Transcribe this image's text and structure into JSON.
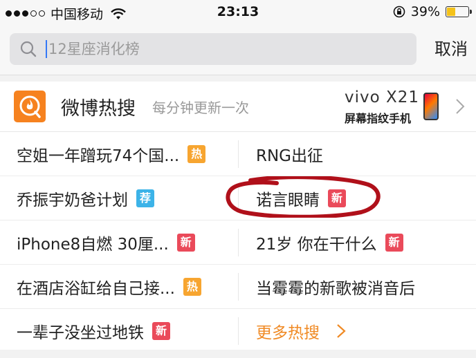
{
  "status_bar": {
    "carrier": "中国移动",
    "time": "23:13",
    "battery": "39%",
    "battery_level": 0.39
  },
  "search": {
    "placeholder": "12星座消化榜",
    "cancel": "取消"
  },
  "card": {
    "title": "微博热搜",
    "subtitle": "每分钟更新一次",
    "ad": {
      "brand": "vivo X21",
      "tagline": "屏幕指纹手机"
    }
  },
  "items": [
    {
      "text": "空姐一年蹭玩74个国...",
      "badge": "热",
      "badge_type": "hot"
    },
    {
      "text": "RNG出征",
      "badge": "",
      "badge_type": ""
    },
    {
      "text": "乔振宇奶爸计划",
      "badge": "荐",
      "badge_type": "rec"
    },
    {
      "text": "诺言眼睛",
      "badge": "新",
      "badge_type": "new"
    },
    {
      "text": "iPhone8自燃 30厘...",
      "badge": "新",
      "badge_type": "new"
    },
    {
      "text": "21岁 你在干什么",
      "badge": "新",
      "badge_type": "new"
    },
    {
      "text": "在酒店浴缸给自己接...",
      "badge": "热",
      "badge_type": "hot"
    },
    {
      "text": "当霉霉的新歌被消音后",
      "badge": "",
      "badge_type": ""
    },
    {
      "text": "一辈子没坐过地铁",
      "badge": "新",
      "badge_type": "new"
    },
    {
      "text": "更多热搜",
      "badge": "",
      "badge_type": ""
    }
  ],
  "colors": {
    "accent_orange": "#f6821f",
    "hot": "#f7a530",
    "new": "#ea4a5a",
    "rec": "#3cb3e8",
    "annotation": "#b0101a"
  }
}
